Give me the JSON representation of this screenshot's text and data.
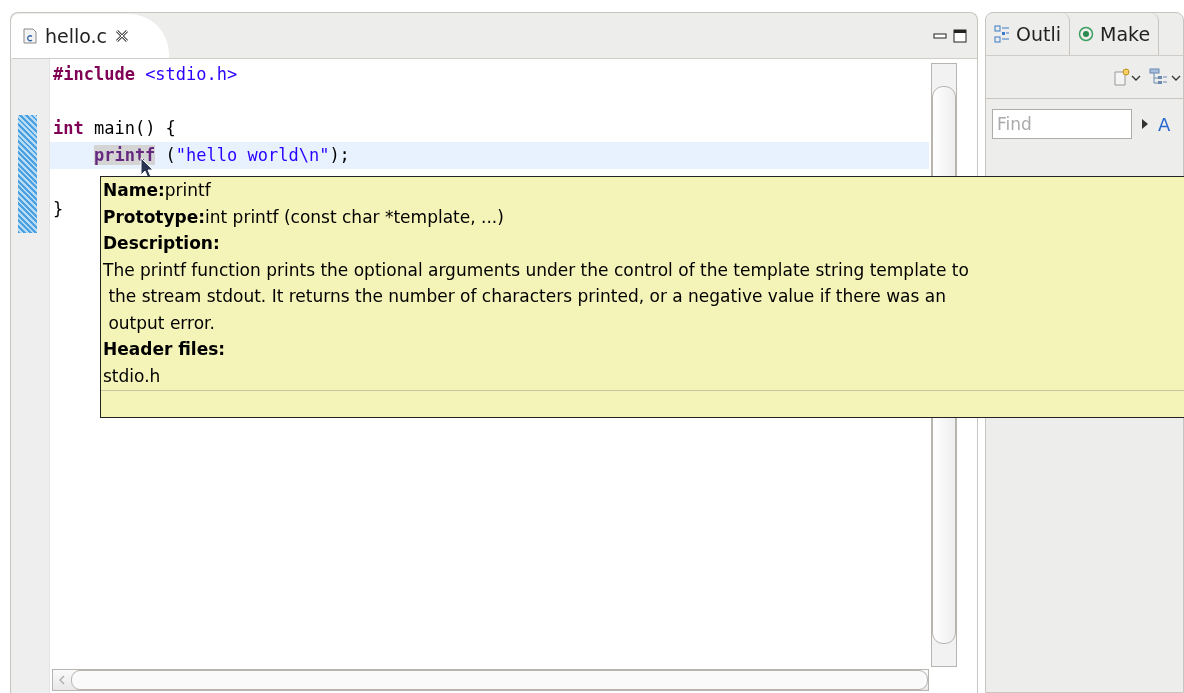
{
  "editor": {
    "tabs": [
      {
        "label": "hello.c",
        "selected": true
      }
    ],
    "code_lines": [
      {
        "current": false,
        "indented": false,
        "tokens": [
          {
            "kind": "keyword",
            "text": "#include"
          },
          {
            "kind": "string",
            "text": " <stdio.h>"
          }
        ]
      },
      {
        "current": false
      },
      {
        "current": false,
        "indented": false,
        "tokens": [
          {
            "kind": "keyword",
            "text": "int"
          },
          {
            "kind": "plain",
            "text": " main() {"
          }
        ]
      },
      {
        "current": true,
        "indented": true,
        "tokens": [
          {
            "kind": "function",
            "text": "printf"
          },
          {
            "kind": "plain",
            "text": " ("
          },
          {
            "kind": "string",
            "text": "\"hello world\\n\""
          },
          {
            "kind": "plain",
            "text": ");"
          }
        ]
      },
      {
        "current": false
      },
      {
        "current": false,
        "indented": false,
        "tokens": [
          {
            "kind": "plain",
            "text": "}"
          }
        ]
      }
    ]
  },
  "hover": {
    "name_label": "Name:",
    "name": "printf",
    "prototype_label": "Prototype:",
    "prototype": "int printf (const char *template, ...)",
    "description_label": "Description:",
    "description": "The printf function prints the optional arguments under the control of the template string template to\n the stream stdout. It returns the number of characters printed, or a negative value if there was an\n output error.",
    "header_label": "Header files:",
    "header": "stdio.h"
  },
  "side_panel": {
    "tabs": [
      {
        "label": "Outli",
        "kind": "outline"
      },
      {
        "label": "Make",
        "kind": "make"
      }
    ],
    "find": {
      "placeholder": "Find"
    },
    "link": "A"
  }
}
